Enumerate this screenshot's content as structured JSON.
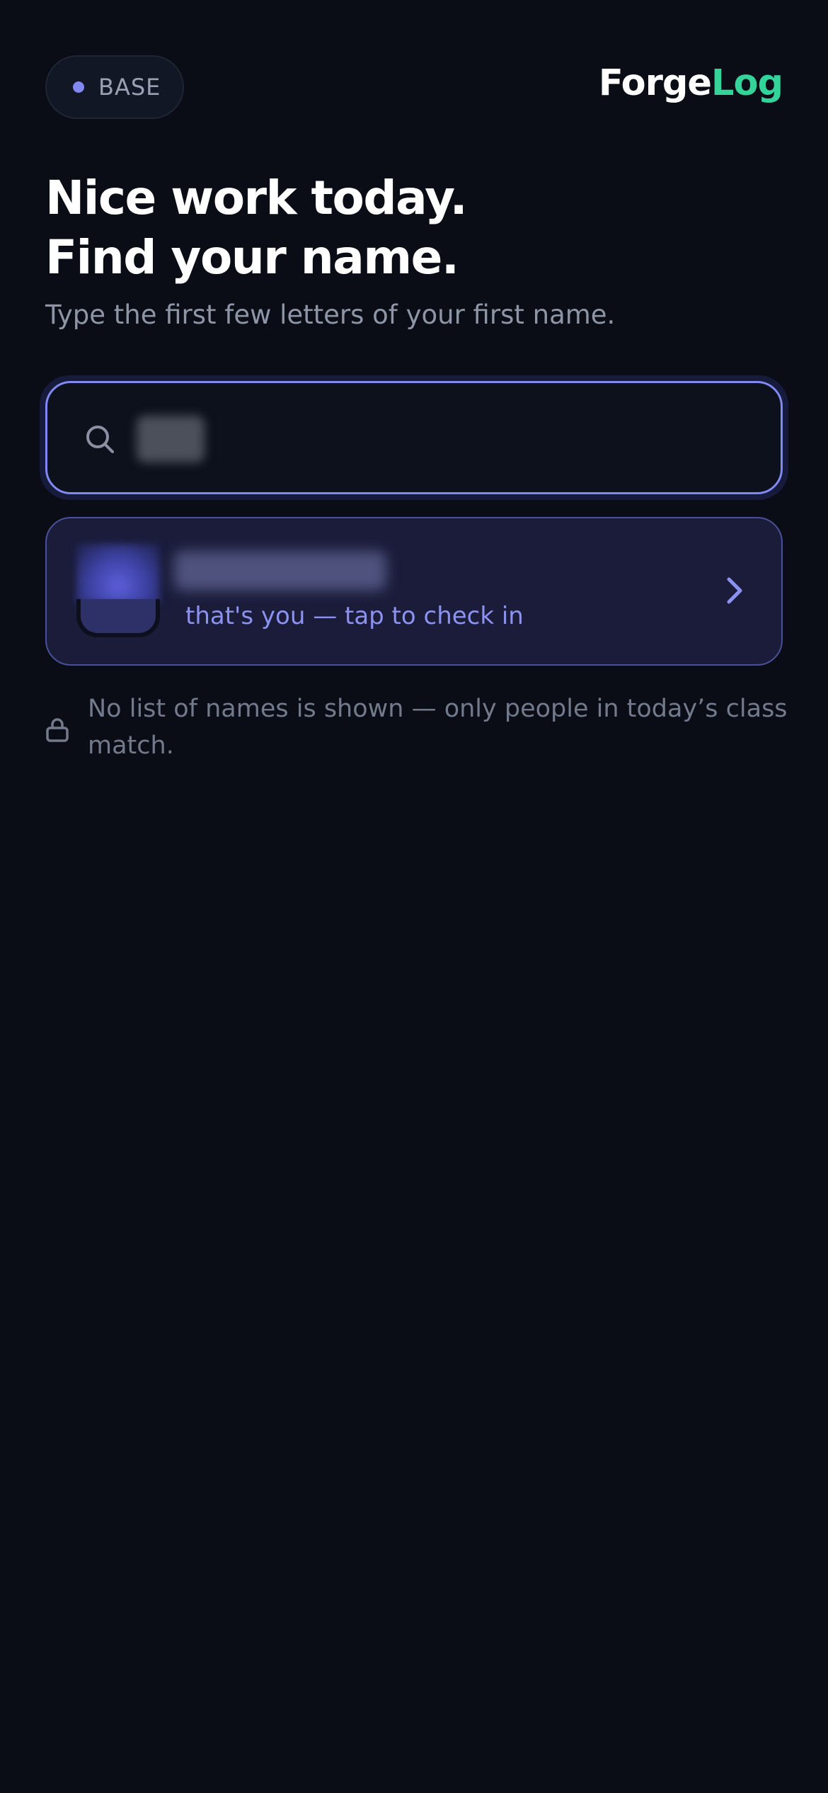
{
  "badge": {
    "label": "BASE"
  },
  "logo": {
    "part_a": "Forge",
    "part_b": "Log"
  },
  "hero": {
    "line1": "Nice work today.",
    "line2": "Find your name."
  },
  "subtitle": "Type the first few letters of your first name.",
  "search": {
    "value": "",
    "icon": "search-icon"
  },
  "result": {
    "name": "",
    "hint": "that's you — tap to check in",
    "icon": "chevron-right-icon"
  },
  "privacy": {
    "icon": "lock-icon",
    "text": "No list of names is shown — only people in today’s class match."
  },
  "colors": {
    "background": "#0a0d15",
    "accent": "#8188f2",
    "brand_green": "#34d39a",
    "card": "#1a1c3a"
  }
}
